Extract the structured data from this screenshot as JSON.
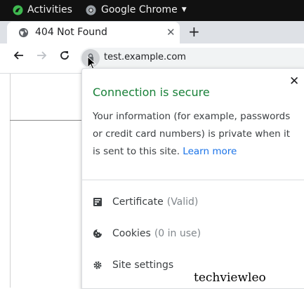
{
  "topbar": {
    "activities": "Activities",
    "app_name": "Google Chrome"
  },
  "tab": {
    "title": "404 Not Found"
  },
  "omnibox": {
    "url": "test.example.com"
  },
  "popup": {
    "heading": "Connection is secure",
    "description": "Your information (for example, passwords or credit card numbers) is private when it is sent to this site.",
    "learn_more": "Learn more",
    "rows": [
      {
        "label": "Certificate",
        "detail": "(Valid)",
        "icon": "certificate-icon"
      },
      {
        "label": "Cookies",
        "detail": "(0 in use)",
        "icon": "cookie-icon"
      },
      {
        "label": "Site settings",
        "detail": "",
        "icon": "settings-icon"
      }
    ]
  },
  "watermark": "techviewleo",
  "colors": {
    "secure_green": "#188038",
    "link_blue": "#1a73e8",
    "topbar_bg": "#111111"
  }
}
